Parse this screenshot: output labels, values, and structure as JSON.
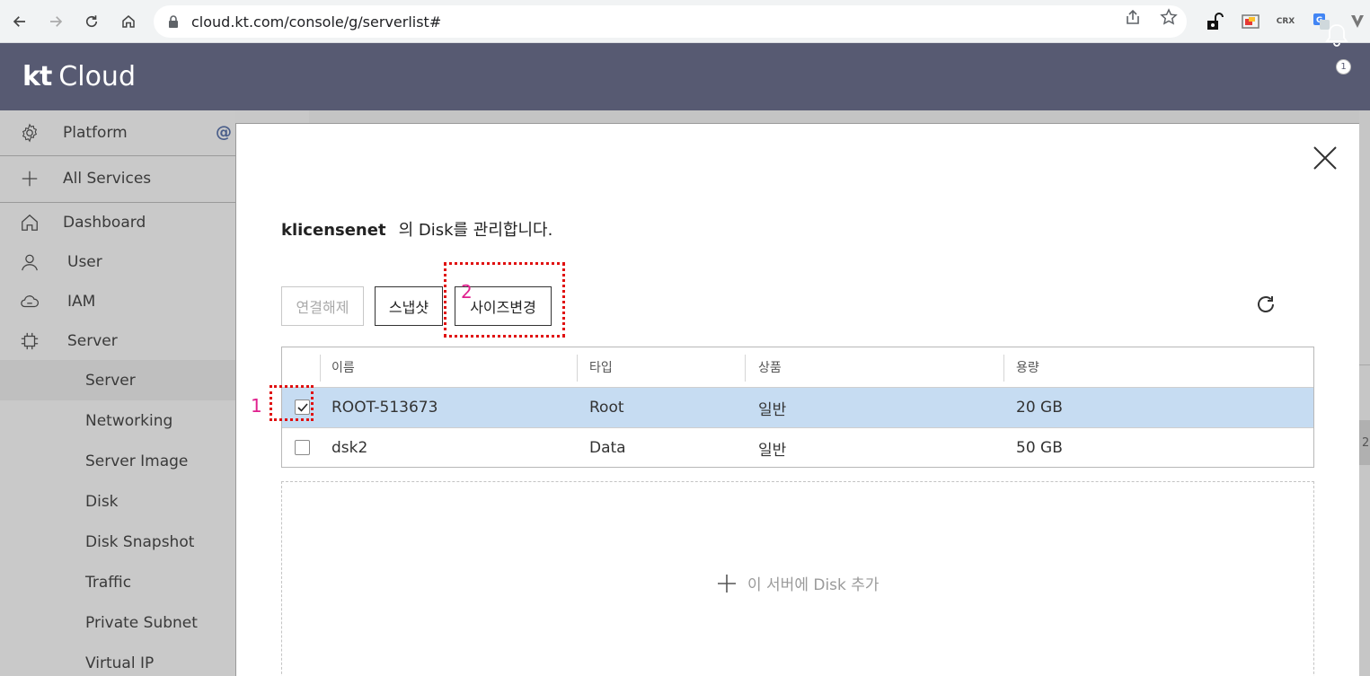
{
  "browser": {
    "url": "cloud.kt.com/console/g/serverlist#",
    "extensions": [
      "CRX"
    ]
  },
  "header": {
    "logo_kt": "kt",
    "logo_cloud": "Cloud",
    "notification_count": "1"
  },
  "sidebar": {
    "top_items": [
      {
        "label": "Platform",
        "icon": "gear-icon"
      },
      {
        "label": "All Services",
        "icon": "plus-icon"
      }
    ],
    "platform_suffix": "@",
    "items": [
      {
        "label": "Dashboard",
        "icon": "home-icon"
      },
      {
        "label": "User",
        "icon": "user-icon"
      },
      {
        "label": "IAM",
        "icon": "cloud-icon"
      },
      {
        "label": "Server",
        "icon": "chip-icon"
      }
    ],
    "sub_items": [
      "Server",
      "Networking",
      "Server Image",
      "Disk",
      "Disk Snapshot",
      "Traffic",
      "Private Subnet",
      "Virtual IP"
    ],
    "active_sub": "Server"
  },
  "modal": {
    "server_name": "klicensenet",
    "title_suffix": "의 Disk를 관리합니다.",
    "buttons": {
      "disconnect": "연결해제",
      "snapshot": "스냅샷",
      "resize": "사이즈변경"
    },
    "table": {
      "headers": [
        "이름",
        "타입",
        "상품",
        "용량"
      ],
      "rows": [
        {
          "name": "ROOT-513673",
          "type": "Root",
          "product": "일반",
          "size": "20 GB",
          "checked": true
        },
        {
          "name": "dsk2",
          "type": "Data",
          "product": "일반",
          "size": "50 GB",
          "checked": false
        }
      ]
    },
    "add_disk_label": "이 서버에 Disk 추가"
  },
  "annotations": [
    "1",
    "2"
  ],
  "right_strip_text": "2",
  "colors": {
    "header_bg": "#575a72",
    "selected_row": "#c6dcf2",
    "annotation_border": "#e01010",
    "annotation_number": "#e0208e"
  }
}
